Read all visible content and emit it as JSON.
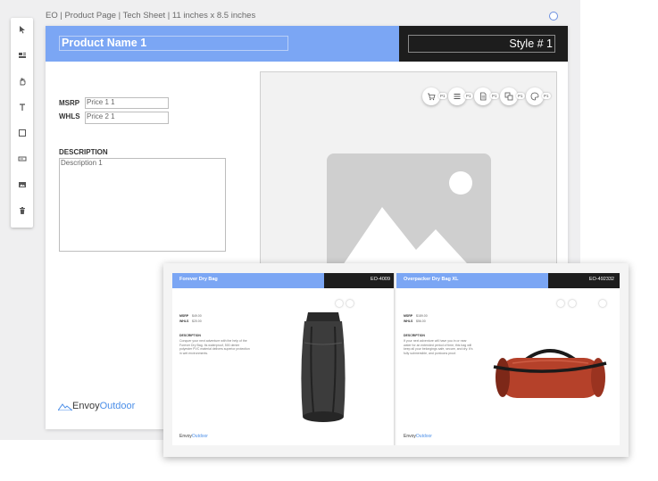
{
  "sheet": {
    "title": "EO | Product Page | Tech Sheet | 11 inches x 8.5 inches"
  },
  "toolbar": {
    "tools": [
      "pointer-icon",
      "layout-icon",
      "hand-icon",
      "text-icon",
      "shape-icon",
      "field-icon",
      "image-icon",
      "trash-icon"
    ]
  },
  "page": {
    "product_name": "Product Name 1",
    "style_number": "Style # 1",
    "msrp_label": "MSRP",
    "msrp_value": "Price 1 1",
    "whls_label": "WHLS",
    "whls_value": "Price 2 1",
    "description_label": "DESCRIPTION",
    "description_value": "Description 1",
    "image_buttons": [
      {
        "icon": "cart-icon",
        "badge": "P1"
      },
      {
        "icon": "list-icon",
        "badge": "P1"
      },
      {
        "icon": "document-icon",
        "badge": "P1"
      },
      {
        "icon": "layers-icon",
        "badge": "P1"
      },
      {
        "icon": "palette-icon",
        "badge": "P1"
      }
    ],
    "logo": {
      "part1": "Envoy",
      "part2": "Outdoor"
    }
  },
  "preview": {
    "left": {
      "name": "Forever Dry Bag",
      "code": "EO-4009",
      "msrp_label": "MSRP",
      "msrp_value": "$49.00",
      "whls_label": "WHLS",
      "whls_value": "$20.00",
      "description_label": "DESCRIPTION",
      "description": "Conquer your next adventure with the help of the Forever Dry Bag. Its waterproof, 500 denier polyester PVC material delivers superior protection in wet environments.",
      "logo": {
        "part1": "Envoy",
        "part2": "Outdoor"
      }
    },
    "right": {
      "name": "Overpacker Dry Bag XL",
      "code": "EO-492332",
      "msrp_label": "MSRP",
      "msrp_value": "$189.00",
      "whls_label": "WHLS",
      "whls_value": "$56.00",
      "description_label": "DESCRIPTION",
      "description": "If your next adventure will have you in or near water for an extended period of time, this bag will keep all your belongings safe, secure, and dry. It's fully submersible, and pontoons proof.",
      "logo": {
        "part1": "Envoy",
        "part2": "Outdoor"
      }
    }
  },
  "colors": {
    "accent_blue": "#7ba6f4",
    "dark_header": "#1d1d1d",
    "logo_blue": "#4c8fe8"
  }
}
